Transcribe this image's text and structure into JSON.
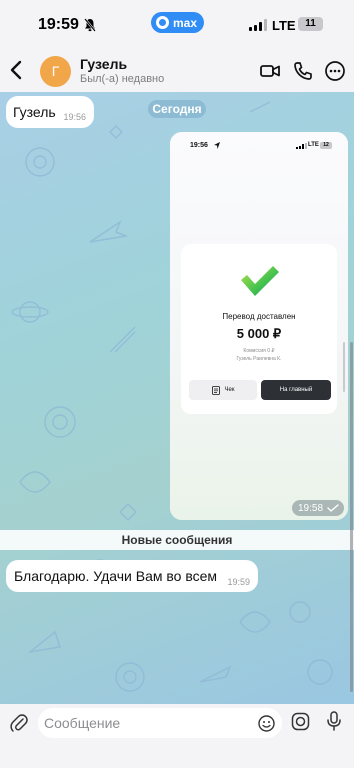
{
  "status_bar": {
    "time": "19:59",
    "app_badge": "max",
    "network": "LTE",
    "battery": "11"
  },
  "header": {
    "avatar_letter": "Г",
    "contact_name": "Гузель",
    "contact_status": "Был(-а) недавно",
    "icons": [
      "back-icon",
      "video-call-icon",
      "phone-icon",
      "more-icon"
    ]
  },
  "chat": {
    "date_separator": "Сегодня",
    "messages": [
      {
        "text": "Гузель",
        "time": "19:56"
      },
      {
        "text": "Благодарю. Удачи Вам во всем",
        "time": "19:59"
      }
    ],
    "photo": {
      "time": "19:58",
      "screenshot": {
        "time": "19:56",
        "network": "LTE",
        "battery": "12",
        "title": "Перевод доставлен",
        "amount": "5 000 ₽",
        "fee": "Комиссия 0 ₽",
        "recipient": "Гузель Раилевна К.",
        "receipt_button": "Чек",
        "main_button": "На главный",
        "accent_color": "#3fc04f"
      }
    },
    "new_messages_label": "Новые сообщения"
  },
  "input": {
    "placeholder": "Сообщение",
    "value": ""
  },
  "colors": {
    "brand": "#2f8df5",
    "avatar": "#f1a64a",
    "bubble": "#ffffff"
  }
}
